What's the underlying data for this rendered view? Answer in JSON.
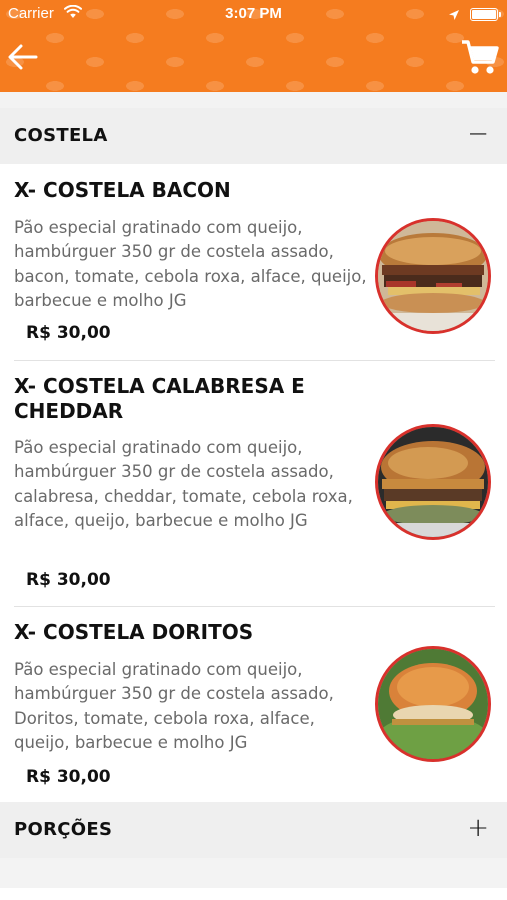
{
  "status_bar": {
    "carrier": "Carrier",
    "time": "3:07 PM",
    "wifi_icon": "wifi-icon",
    "location_icon": "location-arrow-icon",
    "battery_icon": "battery-icon"
  },
  "navbar": {
    "back_icon": "arrow-left-icon",
    "cart_icon": "shopping-cart-icon",
    "background_color": "#f57c1f"
  },
  "sections": [
    {
      "title": "COSTELA",
      "toggle": "−",
      "expanded": true,
      "items": [
        {
          "name": "X- COSTELA BACON",
          "description": "Pão especial gratinado com queijo, hambúrguer 350 gr de costela assado, bacon, tomate, cebola roxa, alface, queijo, barbecue e molho JG",
          "price": "R$ 30,00"
        },
        {
          "name": "X- COSTELA CALABRESA E CHEDDAR",
          "description": "Pão especial gratinado com queijo, hambúrguer 350 gr de costela assado, calabresa, cheddar, tomate, cebola roxa, alface, queijo, barbecue e molho JG",
          "price": "R$ 30,00"
        },
        {
          "name": "X- COSTELA DORITOS",
          "description": "Pão especial gratinado com queijo, hambúrguer 350 gr de costela assado, Doritos, tomate, cebola roxa, alface, queijo, barbecue e molho JG",
          "price": "R$ 30,00"
        }
      ]
    },
    {
      "title": "PORÇÕES",
      "toggle": "+",
      "expanded": false
    }
  ],
  "colors": {
    "accent": "#f57c1f",
    "photo_border": "#d8312c",
    "section_bg": "#efefef",
    "description_text": "#6a6a6a"
  }
}
